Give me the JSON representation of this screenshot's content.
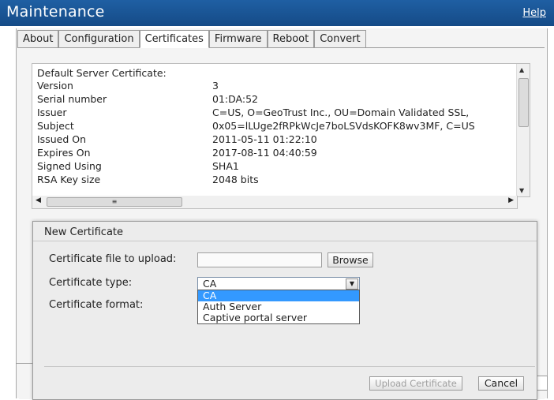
{
  "header": {
    "title": "Maintenance",
    "help": "Help"
  },
  "tabs": [
    {
      "label": "About"
    },
    {
      "label": "Configuration"
    },
    {
      "label": "Certificates"
    },
    {
      "label": "Firmware"
    },
    {
      "label": "Reboot"
    },
    {
      "label": "Convert"
    }
  ],
  "active_tab": "Certificates",
  "certificate": {
    "heading": "Default Server Certificate:",
    "rows": [
      {
        "key": "Version",
        "value": "3"
      },
      {
        "key": "Serial number",
        "value": "01:DA:52"
      },
      {
        "key": "Issuer",
        "value": "C=US, O=GeoTrust Inc., OU=Domain Validated SSL,"
      },
      {
        "key": "Subject",
        "value": "0x05=lLUge2fRPkWcJe7boLSVdsKOFK8wv3MF, C=US"
      },
      {
        "key": "Issued On",
        "value": "2011-05-11 01:22:10"
      },
      {
        "key": "Expires On",
        "value": "2017-08-11 04:40:59"
      },
      {
        "key": "Signed Using",
        "value": "SHA1"
      },
      {
        "key": "RSA Key size",
        "value": "2048 bits"
      }
    ]
  },
  "modal": {
    "title": "New Certificate",
    "file_label": "Certificate file to upload:",
    "browse": "Browse",
    "type_label": "Certificate type:",
    "type_value": "CA",
    "type_options": [
      "CA",
      "Auth Server",
      "Captive portal server"
    ],
    "format_label": "Certificate format:",
    "upload": "Upload Certificate",
    "cancel": "Cancel"
  }
}
